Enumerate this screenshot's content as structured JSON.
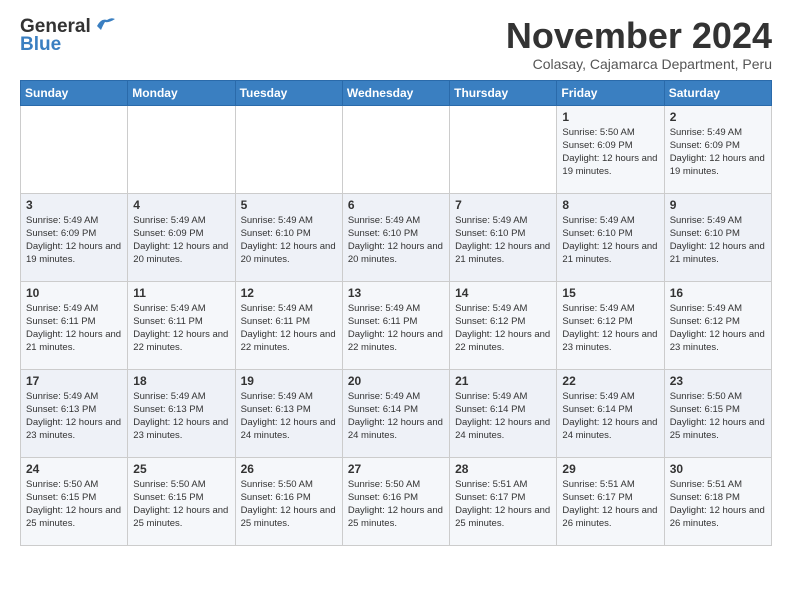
{
  "header": {
    "logo_line1": "General",
    "logo_line2": "Blue",
    "month_title": "November 2024",
    "location": "Colasay, Cajamarca Department, Peru"
  },
  "days_of_week": [
    "Sunday",
    "Monday",
    "Tuesday",
    "Wednesday",
    "Thursday",
    "Friday",
    "Saturday"
  ],
  "weeks": [
    [
      {
        "day": "",
        "info": ""
      },
      {
        "day": "",
        "info": ""
      },
      {
        "day": "",
        "info": ""
      },
      {
        "day": "",
        "info": ""
      },
      {
        "day": "",
        "info": ""
      },
      {
        "day": "1",
        "info": "Sunrise: 5:50 AM\nSunset: 6:09 PM\nDaylight: 12 hours and 19 minutes."
      },
      {
        "day": "2",
        "info": "Sunrise: 5:49 AM\nSunset: 6:09 PM\nDaylight: 12 hours and 19 minutes."
      }
    ],
    [
      {
        "day": "3",
        "info": "Sunrise: 5:49 AM\nSunset: 6:09 PM\nDaylight: 12 hours and 19 minutes."
      },
      {
        "day": "4",
        "info": "Sunrise: 5:49 AM\nSunset: 6:09 PM\nDaylight: 12 hours and 20 minutes."
      },
      {
        "day": "5",
        "info": "Sunrise: 5:49 AM\nSunset: 6:10 PM\nDaylight: 12 hours and 20 minutes."
      },
      {
        "day": "6",
        "info": "Sunrise: 5:49 AM\nSunset: 6:10 PM\nDaylight: 12 hours and 20 minutes."
      },
      {
        "day": "7",
        "info": "Sunrise: 5:49 AM\nSunset: 6:10 PM\nDaylight: 12 hours and 21 minutes."
      },
      {
        "day": "8",
        "info": "Sunrise: 5:49 AM\nSunset: 6:10 PM\nDaylight: 12 hours and 21 minutes."
      },
      {
        "day": "9",
        "info": "Sunrise: 5:49 AM\nSunset: 6:10 PM\nDaylight: 12 hours and 21 minutes."
      }
    ],
    [
      {
        "day": "10",
        "info": "Sunrise: 5:49 AM\nSunset: 6:11 PM\nDaylight: 12 hours and 21 minutes."
      },
      {
        "day": "11",
        "info": "Sunrise: 5:49 AM\nSunset: 6:11 PM\nDaylight: 12 hours and 22 minutes."
      },
      {
        "day": "12",
        "info": "Sunrise: 5:49 AM\nSunset: 6:11 PM\nDaylight: 12 hours and 22 minutes."
      },
      {
        "day": "13",
        "info": "Sunrise: 5:49 AM\nSunset: 6:11 PM\nDaylight: 12 hours and 22 minutes."
      },
      {
        "day": "14",
        "info": "Sunrise: 5:49 AM\nSunset: 6:12 PM\nDaylight: 12 hours and 22 minutes."
      },
      {
        "day": "15",
        "info": "Sunrise: 5:49 AM\nSunset: 6:12 PM\nDaylight: 12 hours and 23 minutes."
      },
      {
        "day": "16",
        "info": "Sunrise: 5:49 AM\nSunset: 6:12 PM\nDaylight: 12 hours and 23 minutes."
      }
    ],
    [
      {
        "day": "17",
        "info": "Sunrise: 5:49 AM\nSunset: 6:13 PM\nDaylight: 12 hours and 23 minutes."
      },
      {
        "day": "18",
        "info": "Sunrise: 5:49 AM\nSunset: 6:13 PM\nDaylight: 12 hours and 23 minutes."
      },
      {
        "day": "19",
        "info": "Sunrise: 5:49 AM\nSunset: 6:13 PM\nDaylight: 12 hours and 24 minutes."
      },
      {
        "day": "20",
        "info": "Sunrise: 5:49 AM\nSunset: 6:14 PM\nDaylight: 12 hours and 24 minutes."
      },
      {
        "day": "21",
        "info": "Sunrise: 5:49 AM\nSunset: 6:14 PM\nDaylight: 12 hours and 24 minutes."
      },
      {
        "day": "22",
        "info": "Sunrise: 5:49 AM\nSunset: 6:14 PM\nDaylight: 12 hours and 24 minutes."
      },
      {
        "day": "23",
        "info": "Sunrise: 5:50 AM\nSunset: 6:15 PM\nDaylight: 12 hours and 25 minutes."
      }
    ],
    [
      {
        "day": "24",
        "info": "Sunrise: 5:50 AM\nSunset: 6:15 PM\nDaylight: 12 hours and 25 minutes."
      },
      {
        "day": "25",
        "info": "Sunrise: 5:50 AM\nSunset: 6:15 PM\nDaylight: 12 hours and 25 minutes."
      },
      {
        "day": "26",
        "info": "Sunrise: 5:50 AM\nSunset: 6:16 PM\nDaylight: 12 hours and 25 minutes."
      },
      {
        "day": "27",
        "info": "Sunrise: 5:50 AM\nSunset: 6:16 PM\nDaylight: 12 hours and 25 minutes."
      },
      {
        "day": "28",
        "info": "Sunrise: 5:51 AM\nSunset: 6:17 PM\nDaylight: 12 hours and 25 minutes."
      },
      {
        "day": "29",
        "info": "Sunrise: 5:51 AM\nSunset: 6:17 PM\nDaylight: 12 hours and 26 minutes."
      },
      {
        "day": "30",
        "info": "Sunrise: 5:51 AM\nSunset: 6:18 PM\nDaylight: 12 hours and 26 minutes."
      }
    ]
  ]
}
